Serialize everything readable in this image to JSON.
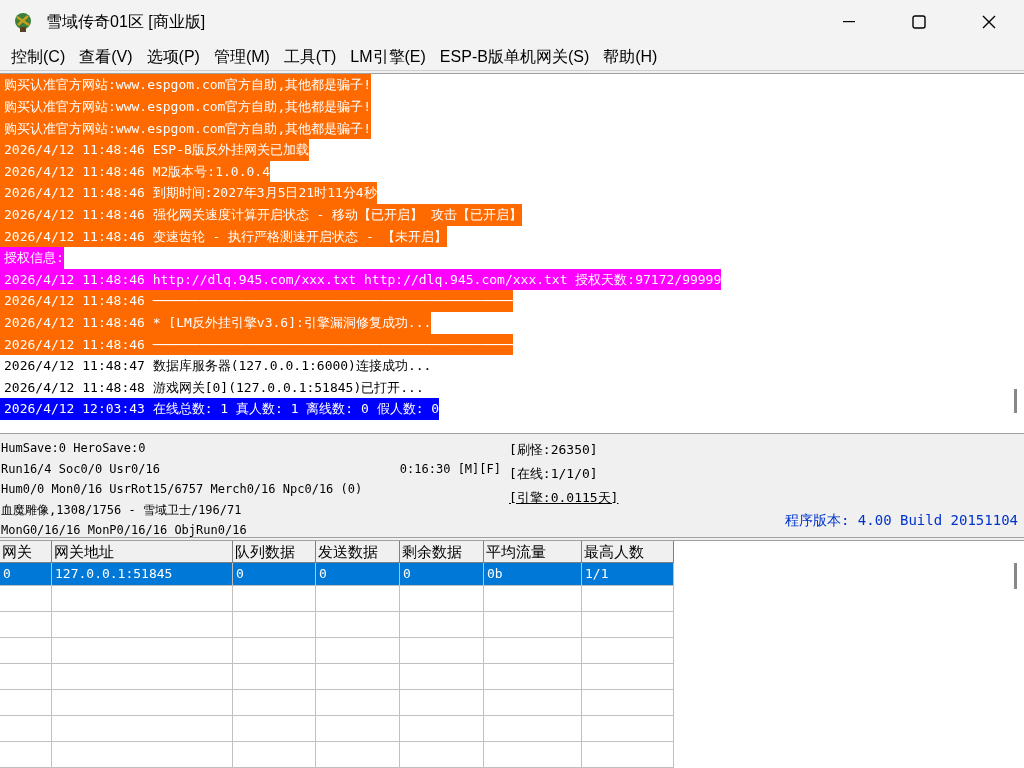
{
  "window": {
    "title": "雪域传奇01区 [商业版]"
  },
  "menu": [
    "控制(C)",
    "查看(V)",
    "选项(P)",
    "管理(M)",
    "工具(T)",
    "LM引擎(E)",
    "ESP-B版单机网关(S)",
    "帮助(H)"
  ],
  "log": [
    {
      "text": "购买认准官方网站:www.espgom.com官方自助,其他都是骗子!",
      "color": "#ff6a00"
    },
    {
      "text": "购买认准官方网站:www.espgom.com官方自助,其他都是骗子!",
      "color": "#ff6a00"
    },
    {
      "text": "购买认准官方网站:www.espgom.com官方自助,其他都是骗子!",
      "color": "#ff6a00"
    },
    {
      "text": "2026/4/12 11:48:46 ESP-B版反外挂网关已加载",
      "color": "#ff6a00"
    },
    {
      "text": "2026/4/12 11:48:46 M2版本号:1.0.0.4",
      "color": "#ff6a00"
    },
    {
      "text": "2026/4/12 11:48:46 到期时间:2027年3月5日21时11分4秒",
      "color": "#ff6a00"
    },
    {
      "text": "2026/4/12 11:48:46 强化网关速度计算开启状态 - 移动【已开启】 攻击【已开启】",
      "color": "#ff6a00"
    },
    {
      "text": "2026/4/12 11:48:46 变速齿轮 - 执行严格测速开启状态 - 【未开启】",
      "color": "#ff6a00"
    },
    {
      "text": "授权信息:",
      "color": "#ff00ff"
    },
    {
      "text": "2026/4/12 11:48:46 http://dlq.945.com/xxx.txt http://dlq.945.com/xxx.txt 授权天数:97172/99999",
      "color": "#ff00ff"
    },
    {
      "text": "2026/4/12 11:48:46 ──────────────────────────────────────────────",
      "color": "#ff6a00"
    },
    {
      "text": "2026/4/12 11:48:46 * [LM反外挂引擎v3.6]:引擎漏洞修复成功...",
      "color": "#ff6a00"
    },
    {
      "text": "2026/4/12 11:48:46 ──────────────────────────────────────────────",
      "color": "#ff6a00"
    },
    {
      "text": "2026/4/12 11:48:47 数据库服务器(127.0.0.1:6000)连接成功..."
    },
    {
      "text": "2026/4/12 11:48:48 游戏网关[0](127.0.0.1:51845)已打开..."
    },
    {
      "text": "2026/4/12 12:03:43 在线总数: 1 真人数: 1 离线数: 0 假人数: 0",
      "color": "#0000ff"
    }
  ],
  "status": {
    "lines": [
      "HumSave:0 HeroSave:0",
      "Run16/4 Soc0/0 Usr0/16",
      "Hum0/0 Mon0/16 UsrRot15/6757 Merch0/16 Npc0/16 (0)",
      "血魔雕像,1308/1756 - 雪域卫士/196/71",
      "MonG0/16/16 MonP0/16/16 ObjRun0/16"
    ],
    "timer": "0:16:30 [M][F]",
    "stats": [
      {
        "text": "[刷怪:26350]",
        "underlined": false
      },
      {
        "text": "[在线:1/1/0]",
        "underlined": false
      },
      {
        "text": "[引擎:0.0115天]",
        "underlined": true
      }
    ],
    "version": "程序版本: 4.00 Build 20151104"
  },
  "table": {
    "columns": [
      "网关",
      "网关地址",
      "队列数据",
      "发送数据",
      "剩余数据",
      "平均流量",
      "最高人数"
    ],
    "rows": [
      {
        "cells": [
          "0",
          "127.0.0.1:51845",
          "0",
          "0",
          "0",
          "0b",
          "1/1"
        ],
        "selected": true
      }
    ]
  }
}
